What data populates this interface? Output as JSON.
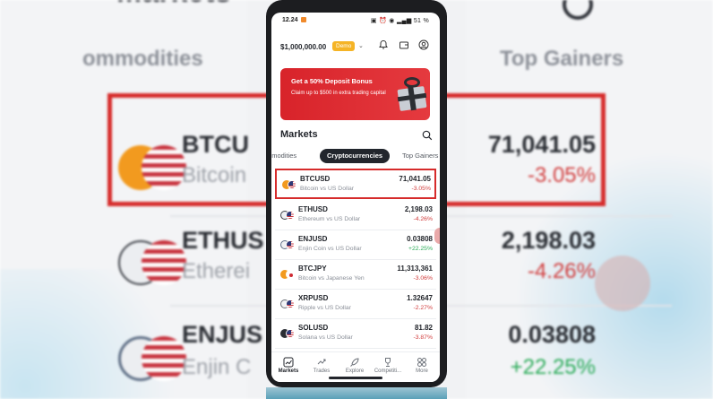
{
  "status_bar": {
    "time": "12.24",
    "right_text": "▣ ⏰ ◉ ▂▄▆ 51 %"
  },
  "header": {
    "balance": "$1,000,000.00",
    "account_type": "Demo"
  },
  "promo": {
    "title": "Get a 50% Deposit Bonus",
    "text": "Claim up to $500 in extra trading capital"
  },
  "markets": {
    "title": "Markets",
    "tabs": [
      {
        "label": "mmodities",
        "active": false
      },
      {
        "label": "Cryptocurrencies",
        "active": true
      },
      {
        "label": "Top Gainers",
        "active": false
      }
    ],
    "rows": [
      {
        "symbol": "BTCUSD",
        "name": "Bitcoin vs US Dollar",
        "price": "71,041.05",
        "change": "-3.05%",
        "coin_color": "#f29a1f",
        "quote": "us",
        "highlight": true
      },
      {
        "symbol": "ETHUSD",
        "name": "Ethereum vs US Dollar",
        "price": "2,198.03",
        "change": "-4.26%",
        "coin_color": "#3c3f46",
        "quote": "us",
        "highlight": false
      },
      {
        "symbol": "ENJUSD",
        "name": "Enjin Coin vs US Dollar",
        "price": "0.03808",
        "change": "+22.25%",
        "coin_color": "#5f6f86",
        "quote": "us",
        "highlight": false
      },
      {
        "symbol": "BTCJPY",
        "name": "Bitcoin vs Japanese Yen",
        "price": "11,313,361",
        "change": "-3.06%",
        "coin_color": "#f29a1f",
        "quote": "jp",
        "highlight": false
      },
      {
        "symbol": "XRPUSD",
        "name": "Ripple vs US Dollar",
        "price": "1.32647",
        "change": "-2.27%",
        "coin_color": "#6b6f77",
        "quote": "us",
        "highlight": false
      },
      {
        "symbol": "SOLUSD",
        "name": "Solana vs US Dollar",
        "price": "81.82",
        "change": "-3.87%",
        "coin_color": "#2a2d33",
        "quote": "us",
        "highlight": false
      }
    ]
  },
  "bottom_nav": [
    {
      "label": "Markets",
      "icon": "chart-icon",
      "active": true
    },
    {
      "label": "Trades",
      "icon": "trades-icon",
      "active": false
    },
    {
      "label": "Explore",
      "icon": "rocket-icon",
      "active": false
    },
    {
      "label": "Competiti...",
      "icon": "trophy-icon",
      "active": false
    },
    {
      "label": "More",
      "icon": "grid-icon",
      "active": false
    }
  ],
  "background": {
    "title": "Markets",
    "tab_left": "ommodities",
    "tab_right": "Top Gainers",
    "rows": [
      {
        "symbol": "BTCU",
        "name": "Bitcoin",
        "price": "71,041.05",
        "change": "-3.05%"
      },
      {
        "symbol": "ETHUS",
        "name": "Etherei",
        "price": "2,198.03",
        "change": "-4.26%"
      },
      {
        "symbol": "ENJUS",
        "name": "Enjin C",
        "price": "0.03808",
        "change": "+22.25%"
      }
    ]
  },
  "colors": {
    "accent_red": "#d62b2b",
    "negative": "#d13c3c",
    "positive": "#2bab58",
    "demo_badge": "#f5b426"
  }
}
